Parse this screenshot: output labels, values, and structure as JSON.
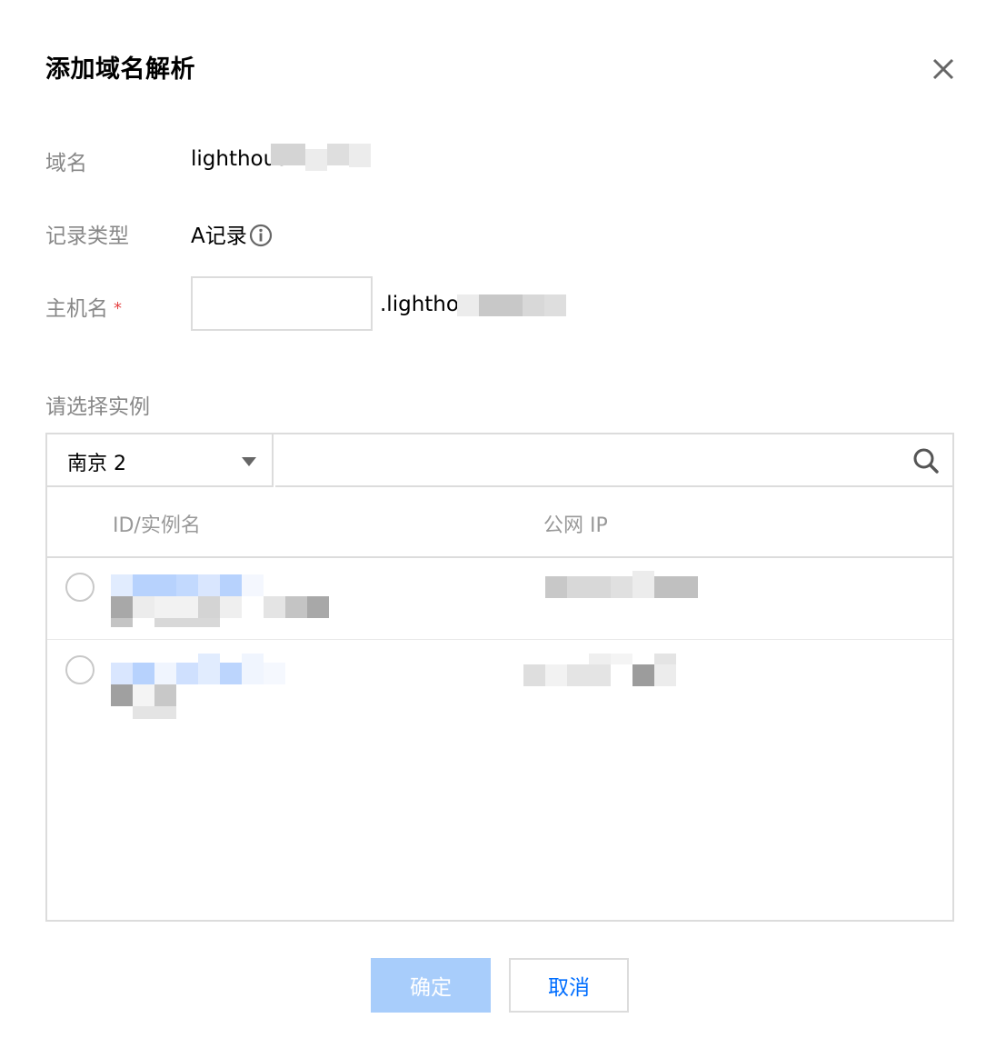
{
  "dialog": {
    "title": "添加域名解析",
    "close_icon": "close-icon"
  },
  "form": {
    "domain_label": "域名",
    "domain_value": "lighthous",
    "record_type_label": "记录类型",
    "record_type_value": "A记录",
    "record_type_info_icon": "info-icon",
    "hostname_label": "主机名",
    "hostname_required_mark": "*",
    "hostname_value": "",
    "hostname_suffix": ".lighthou"
  },
  "instances": {
    "section_label": "请选择实例",
    "region_selected": "南京 2",
    "search_value": "",
    "search_icon": "search-icon",
    "columns": [
      "ID/实例名",
      "公网 IP"
    ],
    "rows": [
      {
        "selected": false
      },
      {
        "selected": false
      }
    ]
  },
  "footer": {
    "confirm_label": "确定",
    "cancel_label": "取消"
  },
  "colors": {
    "primary": "#006eff",
    "confirm_disabled_bg": "#a8cdfb",
    "label_gray": "#888888",
    "border": "#dcdcdc",
    "required": "#e54545"
  }
}
